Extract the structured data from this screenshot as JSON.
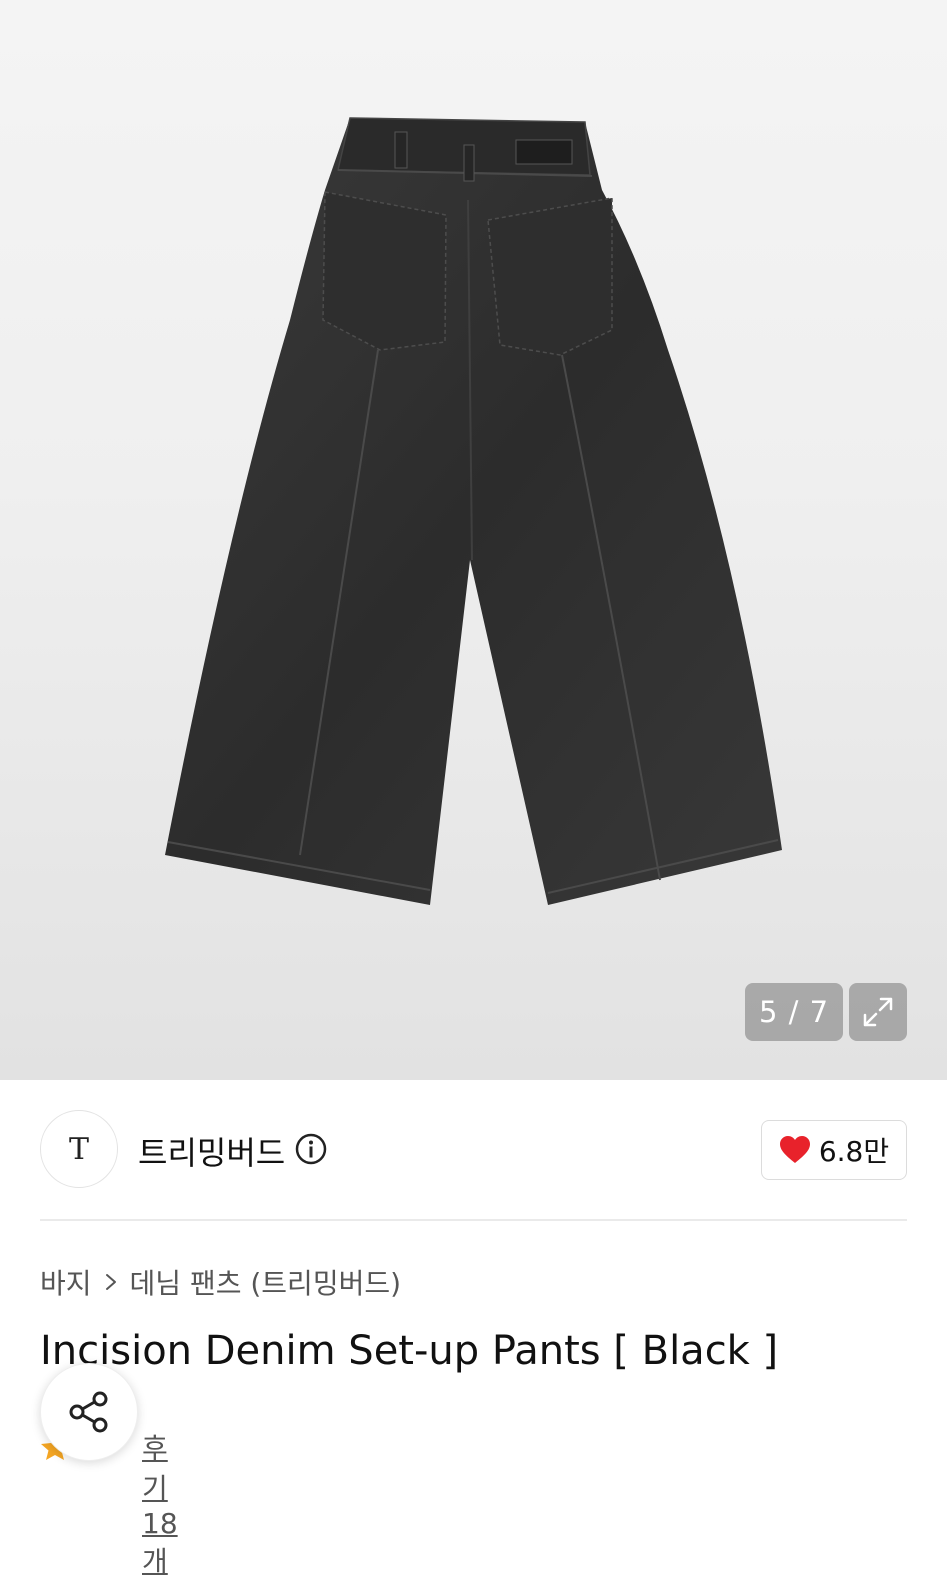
{
  "gallery": {
    "counter": "5 / 7",
    "image_alt": "Black wide denim pants, back view"
  },
  "brand": {
    "logo_text": "T",
    "name": "트리밍버드",
    "likes": "6.8만"
  },
  "breadcrumb": {
    "category": "바지",
    "separator": ">",
    "subcategory": "데님 팬츠 (트리밍버드)"
  },
  "product": {
    "title": "Incision Denim Set-up Pants [ Black ]"
  },
  "rating": {
    "reviews_label": "후기 18개"
  },
  "colors": {
    "heart": "#e8222b",
    "star": "#f5a623"
  }
}
